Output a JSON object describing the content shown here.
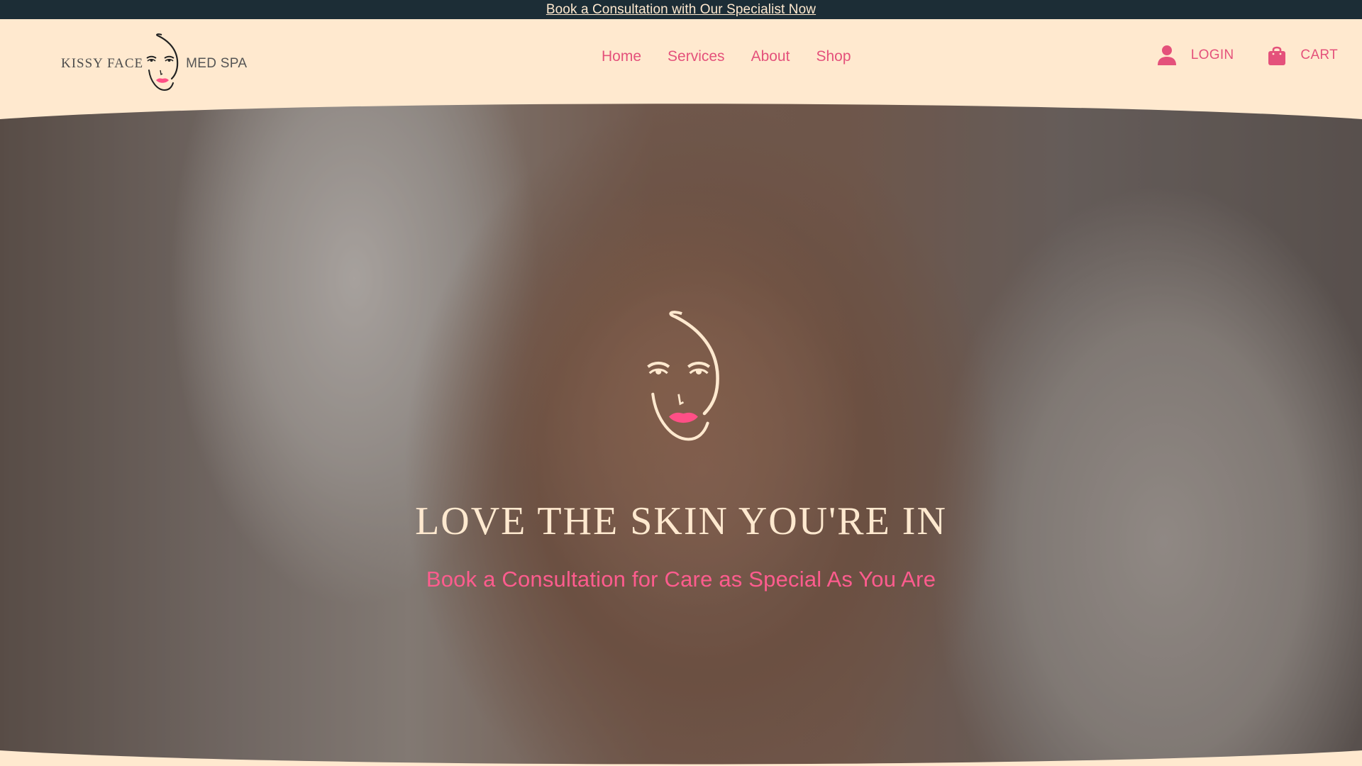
{
  "announcement": {
    "text": "Book a Consultation with Our Specialist Now"
  },
  "logo": {
    "left_text": "KISSY FACE",
    "right_text": "MED SPA",
    "icon": "face-line-art-icon"
  },
  "nav": {
    "items": [
      "Home",
      "Services",
      "About",
      "Shop"
    ]
  },
  "utility": {
    "login": {
      "label": "LOGIN",
      "icon": "user-icon"
    },
    "cart": {
      "label": "CART",
      "icon": "shopping-bag-icon"
    }
  },
  "hero": {
    "title": "LOVE THE SKIN YOU'RE IN",
    "subtitle": "Book a Consultation for Care as Special As You Are",
    "icon": "face-line-art-icon"
  },
  "colors": {
    "background": "#ffe9cf",
    "announcement_bg": "#1c2d36",
    "accent_pink": "#e4517b",
    "hero_title": "#ffe9cf",
    "hero_subtitle": "#ff5c8e"
  }
}
